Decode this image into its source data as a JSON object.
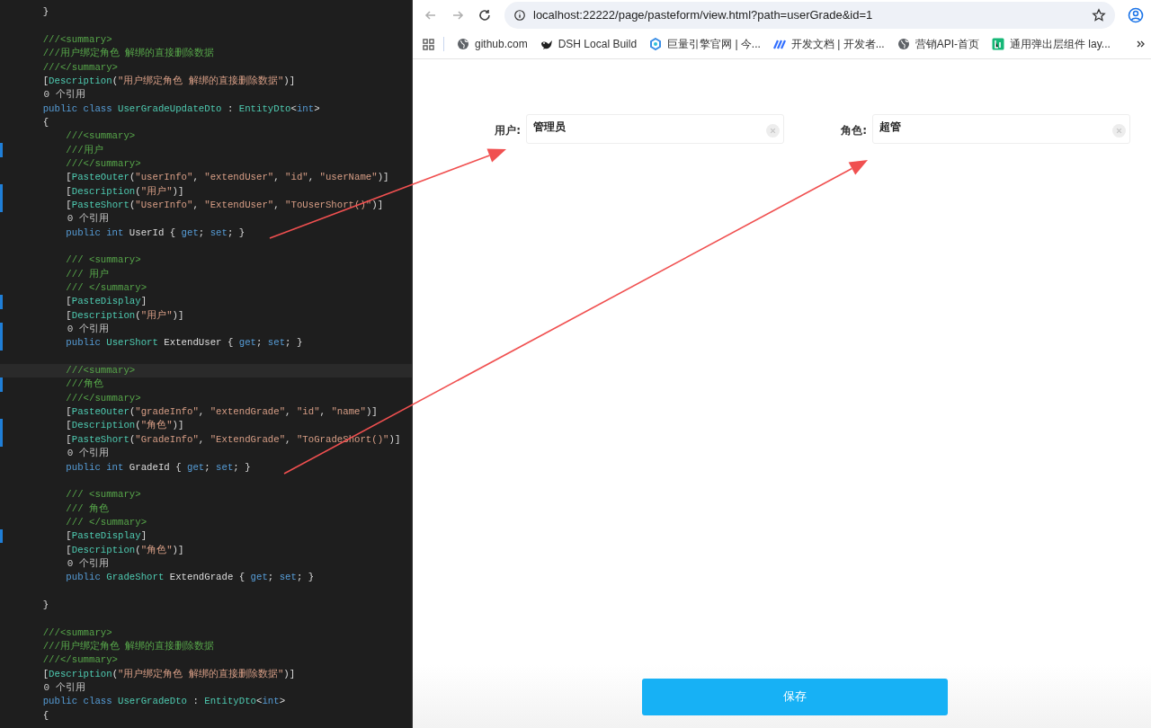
{
  "editor": {
    "lines": [
      {
        "changed": false,
        "current": false,
        "segments": [
          {
            "text": "    }",
            "kind": "plain"
          }
        ]
      },
      {
        "changed": false,
        "current": false
      },
      {
        "changed": false,
        "current": false,
        "segments": [
          {
            "text": "    ///<summary>",
            "kind": "comment"
          }
        ]
      },
      {
        "changed": false,
        "current": false,
        "segments": [
          {
            "text": "    ///用户绑定角色 解绑的直接删除数据",
            "kind": "comment"
          }
        ]
      },
      {
        "changed": false,
        "current": false,
        "segments": [
          {
            "text": "    ///</summary>",
            "kind": "comment"
          }
        ]
      },
      {
        "changed": false,
        "current": false,
        "segments": [
          {
            "text": "    [",
            "kind": "plain"
          },
          {
            "text": "Description",
            "kind": "type"
          },
          {
            "text": "(",
            "kind": "plain"
          },
          {
            "text": "\"用户绑定角色 解绑的直接删除数据\"",
            "kind": "string"
          },
          {
            "text": ")]",
            "kind": "plain"
          }
        ]
      },
      {
        "changed": false,
        "current": false,
        "segments": [
          {
            "text": "    0 个引用",
            "kind": "refs"
          }
        ]
      },
      {
        "changed": false,
        "current": false,
        "segments": [
          {
            "text": "    public class ",
            "kind": "keyword"
          },
          {
            "text": "UserGradeUpdateDto",
            "kind": "type"
          },
          {
            "text": " : ",
            "kind": "plain"
          },
          {
            "text": "EntityDto",
            "kind": "type"
          },
          {
            "text": "<",
            "kind": "plain"
          },
          {
            "text": "int",
            "kind": "keyword"
          },
          {
            "text": ">",
            "kind": "plain"
          }
        ]
      },
      {
        "changed": false,
        "current": false,
        "segments": [
          {
            "text": "    {",
            "kind": "plain"
          }
        ]
      },
      {
        "changed": false,
        "current": false,
        "segments": [
          {
            "text": "        ///<summary>",
            "kind": "comment"
          }
        ]
      },
      {
        "changed": true,
        "current": false,
        "segments": [
          {
            "text": "        ///用户",
            "kind": "comment"
          }
        ]
      },
      {
        "changed": false,
        "current": false,
        "segments": [
          {
            "text": "        ///</summary>",
            "kind": "comment"
          }
        ]
      },
      {
        "changed": false,
        "current": false,
        "segments": [
          {
            "text": "        [",
            "kind": "plain"
          },
          {
            "text": "PasteOuter",
            "kind": "type"
          },
          {
            "text": "(",
            "kind": "plain"
          },
          {
            "text": "\"userInfo\"",
            "kind": "string"
          },
          {
            "text": ", ",
            "kind": "plain"
          },
          {
            "text": "\"extendUser\"",
            "kind": "string"
          },
          {
            "text": ", ",
            "kind": "plain"
          },
          {
            "text": "\"id\"",
            "kind": "string"
          },
          {
            "text": ", ",
            "kind": "plain"
          },
          {
            "text": "\"userName\"",
            "kind": "string"
          },
          {
            "text": ")]",
            "kind": "plain"
          }
        ]
      },
      {
        "changed": true,
        "current": false,
        "segments": [
          {
            "text": "        [",
            "kind": "plain"
          },
          {
            "text": "Description",
            "kind": "type"
          },
          {
            "text": "(",
            "kind": "plain"
          },
          {
            "text": "\"用户\"",
            "kind": "string"
          },
          {
            "text": ")]",
            "kind": "plain"
          }
        ]
      },
      {
        "changed": true,
        "current": false,
        "segments": [
          {
            "text": "        [",
            "kind": "plain"
          },
          {
            "text": "PasteShort",
            "kind": "type"
          },
          {
            "text": "(",
            "kind": "plain"
          },
          {
            "text": "\"UserInfo\"",
            "kind": "string"
          },
          {
            "text": ", ",
            "kind": "plain"
          },
          {
            "text": "\"ExtendUser\"",
            "kind": "string"
          },
          {
            "text": ", ",
            "kind": "plain"
          },
          {
            "text": "\"ToUserShort()\"",
            "kind": "string"
          },
          {
            "text": ")]",
            "kind": "plain"
          }
        ]
      },
      {
        "changed": false,
        "current": false,
        "segments": [
          {
            "text": "        0 个引用",
            "kind": "refs"
          }
        ]
      },
      {
        "changed": false,
        "current": false,
        "segments": [
          {
            "text": "        public int ",
            "kind": "keyword"
          },
          {
            "text": "UserId { ",
            "kind": "plain"
          },
          {
            "text": "get",
            "kind": "keyword"
          },
          {
            "text": "; ",
            "kind": "plain"
          },
          {
            "text": "set",
            "kind": "keyword"
          },
          {
            "text": "; }",
            "kind": "plain"
          }
        ]
      },
      {
        "changed": false,
        "current": false
      },
      {
        "changed": false,
        "current": false,
        "segments": [
          {
            "text": "        /// <summary>",
            "kind": "comment"
          }
        ]
      },
      {
        "changed": false,
        "current": false,
        "segments": [
          {
            "text": "        /// 用户",
            "kind": "comment"
          }
        ]
      },
      {
        "changed": false,
        "current": false,
        "segments": [
          {
            "text": "        /// </summary>",
            "kind": "comment"
          }
        ]
      },
      {
        "changed": true,
        "current": false,
        "segments": [
          {
            "text": "        [",
            "kind": "plain"
          },
          {
            "text": "PasteDisplay",
            "kind": "type"
          },
          {
            "text": "]",
            "kind": "plain"
          }
        ]
      },
      {
        "changed": false,
        "current": false,
        "segments": [
          {
            "text": "        [",
            "kind": "plain"
          },
          {
            "text": "Description",
            "kind": "type"
          },
          {
            "text": "(",
            "kind": "plain"
          },
          {
            "text": "\"用户\"",
            "kind": "string"
          },
          {
            "text": ")]",
            "kind": "plain"
          }
        ]
      },
      {
        "changed": true,
        "current": false,
        "segments": [
          {
            "text": "        0 个引用",
            "kind": "refs"
          }
        ]
      },
      {
        "changed": true,
        "current": false,
        "segments": [
          {
            "text": "        public ",
            "kind": "keyword"
          },
          {
            "text": "UserShort",
            "kind": "type"
          },
          {
            "text": " ExtendUser { ",
            "kind": "plain"
          },
          {
            "text": "get",
            "kind": "keyword"
          },
          {
            "text": "; ",
            "kind": "plain"
          },
          {
            "text": "set",
            "kind": "keyword"
          },
          {
            "text": "; }",
            "kind": "plain"
          }
        ]
      },
      {
        "changed": false,
        "current": false
      },
      {
        "changed": false,
        "current": true,
        "segments": [
          {
            "text": "        ///<summary>",
            "kind": "comment"
          }
        ]
      },
      {
        "changed": true,
        "current": false,
        "segments": [
          {
            "text": "        ///角色",
            "kind": "comment"
          }
        ]
      },
      {
        "changed": false,
        "current": false,
        "segments": [
          {
            "text": "        ///</summary>",
            "kind": "comment"
          }
        ]
      },
      {
        "changed": false,
        "current": false,
        "segments": [
          {
            "text": "        [",
            "kind": "plain"
          },
          {
            "text": "PasteOuter",
            "kind": "type"
          },
          {
            "text": "(",
            "kind": "plain"
          },
          {
            "text": "\"gradeInfo\"",
            "kind": "string"
          },
          {
            "text": ", ",
            "kind": "plain"
          },
          {
            "text": "\"extendGrade\"",
            "kind": "string"
          },
          {
            "text": ", ",
            "kind": "plain"
          },
          {
            "text": "\"id\"",
            "kind": "string"
          },
          {
            "text": ", ",
            "kind": "plain"
          },
          {
            "text": "\"name\"",
            "kind": "string"
          },
          {
            "text": ")]",
            "kind": "plain"
          }
        ]
      },
      {
        "changed": true,
        "current": false,
        "segments": [
          {
            "text": "        [",
            "kind": "plain"
          },
          {
            "text": "Description",
            "kind": "type"
          },
          {
            "text": "(",
            "kind": "plain"
          },
          {
            "text": "\"角色\"",
            "kind": "string"
          },
          {
            "text": ")]",
            "kind": "plain"
          }
        ]
      },
      {
        "changed": true,
        "current": false,
        "segments": [
          {
            "text": "        [",
            "kind": "plain"
          },
          {
            "text": "PasteShort",
            "kind": "type"
          },
          {
            "text": "(",
            "kind": "plain"
          },
          {
            "text": "\"GradeInfo\"",
            "kind": "string"
          },
          {
            "text": ", ",
            "kind": "plain"
          },
          {
            "text": "\"ExtendGrade\"",
            "kind": "string"
          },
          {
            "text": ", ",
            "kind": "plain"
          },
          {
            "text": "\"ToGradeShort()\"",
            "kind": "string"
          },
          {
            "text": ")]",
            "kind": "plain"
          }
        ]
      },
      {
        "changed": false,
        "current": false,
        "segments": [
          {
            "text": "        0 个引用",
            "kind": "refs"
          }
        ]
      },
      {
        "changed": false,
        "current": false,
        "segments": [
          {
            "text": "        public int ",
            "kind": "keyword"
          },
          {
            "text": "GradeId { ",
            "kind": "plain"
          },
          {
            "text": "get",
            "kind": "keyword"
          },
          {
            "text": "; ",
            "kind": "plain"
          },
          {
            "text": "set",
            "kind": "keyword"
          },
          {
            "text": "; }",
            "kind": "plain"
          }
        ]
      },
      {
        "changed": false,
        "current": false
      },
      {
        "changed": false,
        "current": false,
        "segments": [
          {
            "text": "        /// <summary>",
            "kind": "comment"
          }
        ]
      },
      {
        "changed": false,
        "current": false,
        "segments": [
          {
            "text": "        /// 角色",
            "kind": "comment"
          }
        ]
      },
      {
        "changed": false,
        "current": false,
        "segments": [
          {
            "text": "        /// </summary>",
            "kind": "comment"
          }
        ]
      },
      {
        "changed": true,
        "current": false,
        "segments": [
          {
            "text": "        [",
            "kind": "plain"
          },
          {
            "text": "PasteDisplay",
            "kind": "type"
          },
          {
            "text": "]",
            "kind": "plain"
          }
        ]
      },
      {
        "changed": false,
        "current": false,
        "segments": [
          {
            "text": "        [",
            "kind": "plain"
          },
          {
            "text": "Description",
            "kind": "type"
          },
          {
            "text": "(",
            "kind": "plain"
          },
          {
            "text": "\"角色\"",
            "kind": "string"
          },
          {
            "text": ")]",
            "kind": "plain"
          }
        ]
      },
      {
        "changed": false,
        "current": false,
        "segments": [
          {
            "text": "        0 个引用",
            "kind": "refs"
          }
        ]
      },
      {
        "changed": false,
        "current": false,
        "segments": [
          {
            "text": "        public ",
            "kind": "keyword"
          },
          {
            "text": "GradeShort",
            "kind": "type"
          },
          {
            "text": " ExtendGrade { ",
            "kind": "plain"
          },
          {
            "text": "get",
            "kind": "keyword"
          },
          {
            "text": "; ",
            "kind": "plain"
          },
          {
            "text": "set",
            "kind": "keyword"
          },
          {
            "text": "; }",
            "kind": "plain"
          }
        ]
      },
      {
        "changed": false,
        "current": false
      },
      {
        "changed": false,
        "current": false,
        "segments": [
          {
            "text": "    }",
            "kind": "plain"
          }
        ]
      },
      {
        "changed": false,
        "current": false
      },
      {
        "changed": false,
        "current": false,
        "segments": [
          {
            "text": "    ///<summary>",
            "kind": "comment"
          }
        ]
      },
      {
        "changed": false,
        "current": false,
        "segments": [
          {
            "text": "    ///用户绑定角色 解绑的直接删除数据",
            "kind": "comment"
          }
        ]
      },
      {
        "changed": false,
        "current": false,
        "segments": [
          {
            "text": "    ///</summary>",
            "kind": "comment"
          }
        ]
      },
      {
        "changed": false,
        "current": false,
        "segments": [
          {
            "text": "    [",
            "kind": "plain"
          },
          {
            "text": "Description",
            "kind": "type"
          },
          {
            "text": "(",
            "kind": "plain"
          },
          {
            "text": "\"用户绑定角色 解绑的直接删除数据\"",
            "kind": "string"
          },
          {
            "text": ")]",
            "kind": "plain"
          }
        ]
      },
      {
        "changed": false,
        "current": false,
        "segments": [
          {
            "text": "    0 个引用",
            "kind": "refs"
          }
        ]
      },
      {
        "changed": false,
        "current": false,
        "segments": [
          {
            "text": "    public class ",
            "kind": "keyword"
          },
          {
            "text": "UserGradeDto",
            "kind": "type"
          },
          {
            "text": " : ",
            "kind": "plain"
          },
          {
            "text": "EntityDto",
            "kind": "type"
          },
          {
            "text": "<",
            "kind": "plain"
          },
          {
            "text": "int",
            "kind": "keyword"
          },
          {
            "text": ">",
            "kind": "plain"
          }
        ]
      },
      {
        "changed": false,
        "current": false,
        "segments": [
          {
            "text": "    {",
            "kind": "plain"
          }
        ]
      }
    ]
  },
  "browser": {
    "address": "localhost:22222/page/pasteform/view.html?path=userGrade&id=1",
    "bookmarks": [
      {
        "label": "github.com",
        "kind": "globe"
      },
      {
        "label": "DSH Local Build",
        "kind": "bird"
      },
      {
        "label": "巨量引擎官网 | 今...",
        "kind": "swirl"
      },
      {
        "label": "开发文档 | 开发者...",
        "kind": "stripes"
      },
      {
        "label": "营销API-首页",
        "kind": "globe"
      },
      {
        "label": "通用弹出层组件 lay...",
        "kind": "tile"
      }
    ]
  },
  "form": {
    "fields": [
      {
        "label": "用户:",
        "value": "管理员"
      },
      {
        "label": "角色:",
        "value": "超管"
      }
    ],
    "save_button": "保存"
  }
}
